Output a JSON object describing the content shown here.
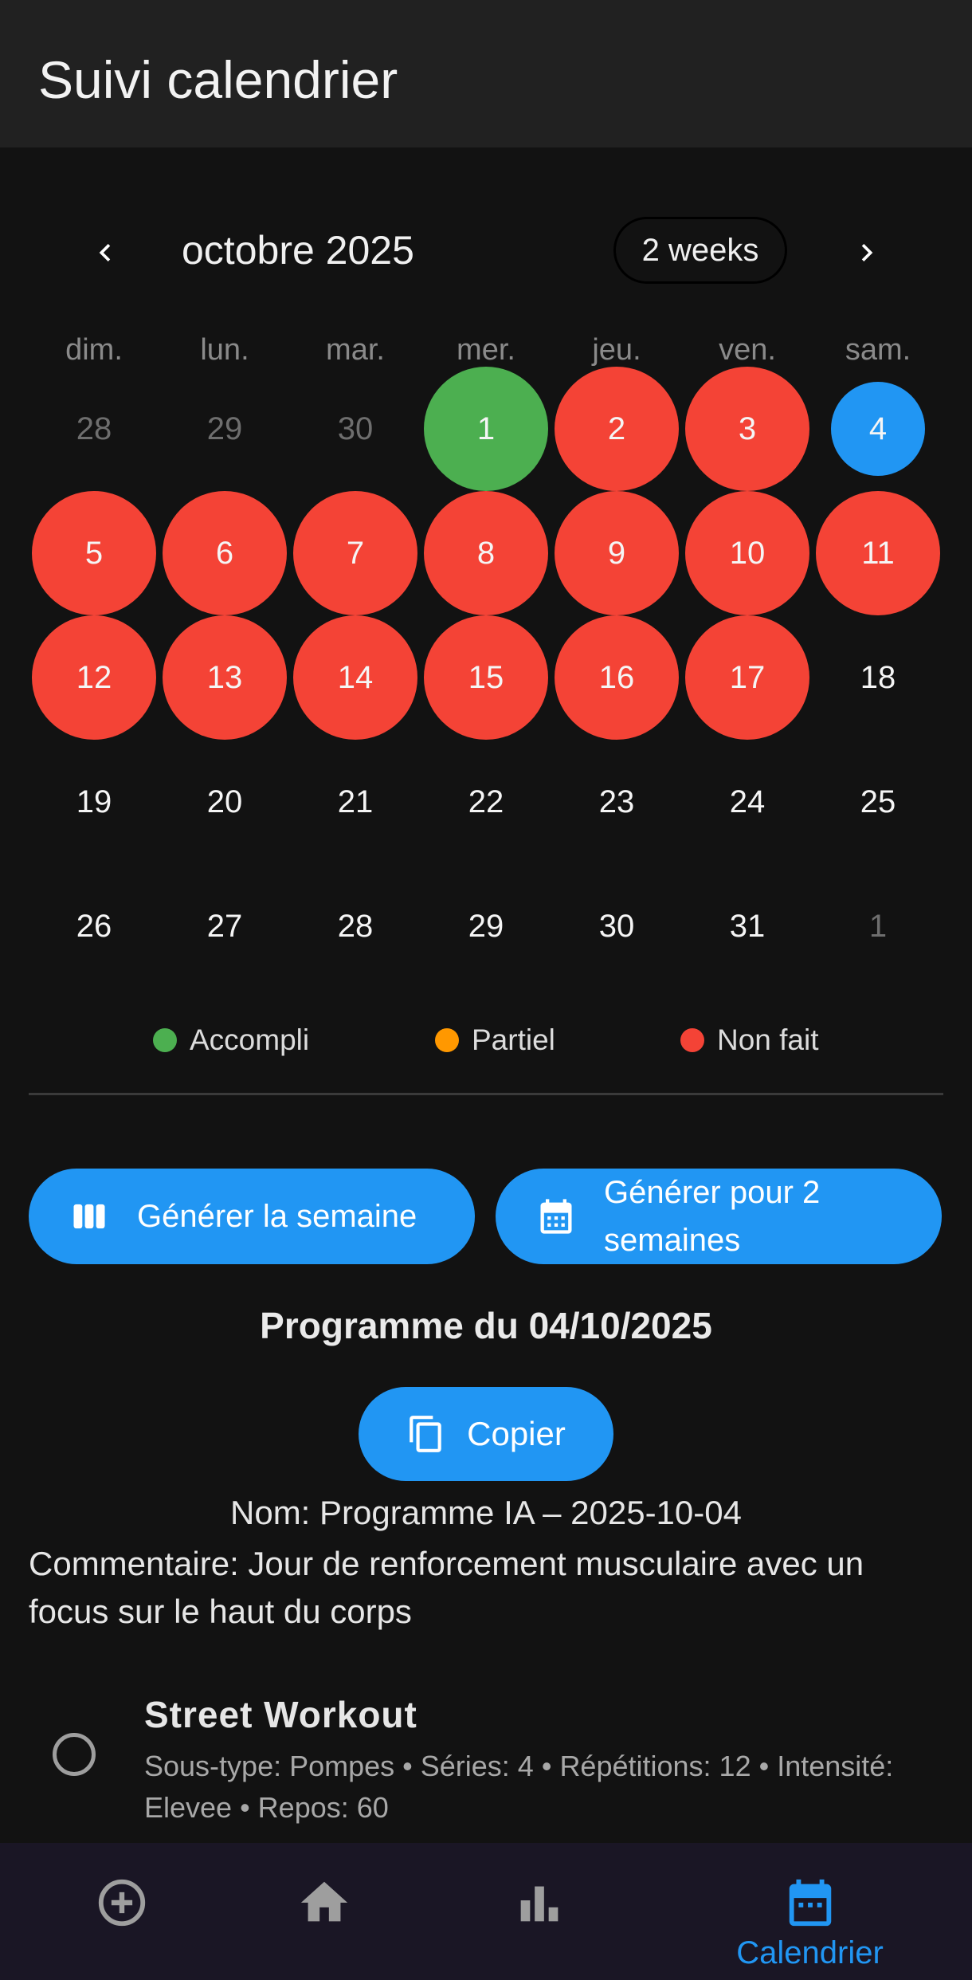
{
  "app_bar": {
    "title": "Suivi calendrier"
  },
  "calendar": {
    "month_label": "octobre 2025",
    "format_button": "2 weeks",
    "weekdays": [
      "dim.",
      "lun.",
      "mar.",
      "mer.",
      "jeu.",
      "ven.",
      "sam."
    ],
    "weeks": [
      [
        {
          "d": "28",
          "s": "outside"
        },
        {
          "d": "29",
          "s": "outside"
        },
        {
          "d": "30",
          "s": "outside"
        },
        {
          "d": "1",
          "s": "done"
        },
        {
          "d": "2",
          "s": "missed"
        },
        {
          "d": "3",
          "s": "missed"
        },
        {
          "d": "4",
          "s": "selected"
        }
      ],
      [
        {
          "d": "5",
          "s": "missed"
        },
        {
          "d": "6",
          "s": "missed"
        },
        {
          "d": "7",
          "s": "missed"
        },
        {
          "d": "8",
          "s": "missed"
        },
        {
          "d": "9",
          "s": "missed"
        },
        {
          "d": "10",
          "s": "missed"
        },
        {
          "d": "11",
          "s": "missed"
        }
      ],
      [
        {
          "d": "12",
          "s": "missed"
        },
        {
          "d": "13",
          "s": "missed"
        },
        {
          "d": "14",
          "s": "missed"
        },
        {
          "d": "15",
          "s": "missed"
        },
        {
          "d": "16",
          "s": "missed"
        },
        {
          "d": "17",
          "s": "missed"
        },
        {
          "d": "18",
          "s": "none"
        }
      ],
      [
        {
          "d": "19",
          "s": "none"
        },
        {
          "d": "20",
          "s": "none"
        },
        {
          "d": "21",
          "s": "none"
        },
        {
          "d": "22",
          "s": "none"
        },
        {
          "d": "23",
          "s": "none"
        },
        {
          "d": "24",
          "s": "none"
        },
        {
          "d": "25",
          "s": "none"
        }
      ],
      [
        {
          "d": "26",
          "s": "none"
        },
        {
          "d": "27",
          "s": "none"
        },
        {
          "d": "28",
          "s": "none"
        },
        {
          "d": "29",
          "s": "none"
        },
        {
          "d": "30",
          "s": "none"
        },
        {
          "d": "31",
          "s": "none"
        },
        {
          "d": "1",
          "s": "outside"
        }
      ]
    ]
  },
  "legend": [
    {
      "label": "Accompli",
      "color": "#4caf50"
    },
    {
      "label": "Partiel",
      "color": "#ff9800"
    },
    {
      "label": "Non fait",
      "color": "#f44336"
    }
  ],
  "actions": {
    "generate_week": "Générer la semaine",
    "generate_two_weeks": "Générer pour 2 semaines"
  },
  "program": {
    "title": "Programme du 04/10/2025",
    "copy_label": "Copier",
    "name_line": "Nom: Programme IA – 2025-10-04",
    "comment_line": "Commentaire: Jour de renforcement musculaire avec un focus sur le haut du corps",
    "exercises": [
      {
        "title": "Street Workout",
        "details": "Sous-type: Pompes • Séries: 4 • Répétitions: 12 • Intensité: Elevee • Repos: 60"
      }
    ]
  },
  "bottom_nav": {
    "items": [
      {
        "icon": "add-circle-icon",
        "label": ""
      },
      {
        "icon": "home-icon",
        "label": ""
      },
      {
        "icon": "bar-chart-icon",
        "label": ""
      },
      {
        "icon": "calendar-icon",
        "label": "Calendrier",
        "active": true
      }
    ]
  },
  "colors": {
    "done": "#4caf50",
    "missed": "#f44336",
    "selected": "#2196f3",
    "accent": "#2196f3"
  }
}
